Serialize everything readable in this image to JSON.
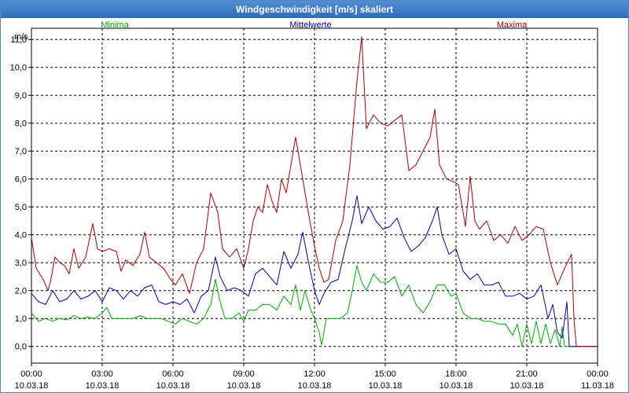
{
  "window": {
    "title": "Windgeschwindigkeit [m/s] skaliert"
  },
  "chart_data": {
    "type": "line",
    "title": "Windgeschwindigkeit [m/s] skaliert",
    "ylabel": "m/s",
    "xlabel": "",
    "ylim": [
      -0.6,
      11.4
    ],
    "grid": true,
    "legend_position": "top",
    "y_ticks": [
      "11,0",
      "10,0",
      "9,0",
      "8,0",
      "7,0",
      "6,0",
      "5,0",
      "4,0",
      "3,0",
      "2,0",
      "1,0",
      "0,0"
    ],
    "y_tick_values": [
      11,
      10,
      9,
      8,
      7,
      6,
      5,
      4,
      3,
      2,
      1,
      0
    ],
    "x_ticks": [
      {
        "time": "00:00",
        "date": "10.03.18"
      },
      {
        "time": "03:00",
        "date": "10.03.18"
      },
      {
        "time": "06:00",
        "date": "10.03.18"
      },
      {
        "time": "09:00",
        "date": "10.03.18"
      },
      {
        "time": "12:00",
        "date": "10.03.18"
      },
      {
        "time": "15:00",
        "date": "10.03.18"
      },
      {
        "time": "18:00",
        "date": "10.03.18"
      },
      {
        "time": "21:00",
        "date": "10.03.18"
      },
      {
        "time": "00:00",
        "date": "11.03.18"
      }
    ],
    "x_tick_hours": [
      0,
      3,
      6,
      9,
      12,
      15,
      18,
      21,
      24
    ],
    "x_unit": "hours since 10.03.18 00:00",
    "series": [
      {
        "name": "Minima",
        "color": "#00aa00",
        "points": [
          [
            0,
            1.2
          ],
          [
            0.3,
            0.9
          ],
          [
            0.6,
            1.0
          ],
          [
            0.9,
            0.9
          ],
          [
            1.2,
            1.0
          ],
          [
            1.5,
            0.95
          ],
          [
            1.8,
            1.1
          ],
          [
            2.1,
            1.0
          ],
          [
            2.4,
            1.05
          ],
          [
            2.7,
            1.0
          ],
          [
            3.0,
            1.2
          ],
          [
            3.2,
            1.4
          ],
          [
            3.4,
            1.0
          ],
          [
            3.7,
            1.0
          ],
          [
            4.0,
            1.0
          ],
          [
            4.3,
            1.0
          ],
          [
            4.6,
            1.1
          ],
          [
            4.9,
            1.0
          ],
          [
            5.2,
            1.0
          ],
          [
            5.5,
            1.0
          ],
          [
            5.8,
            0.9
          ],
          [
            6.1,
            0.8
          ],
          [
            6.4,
            1.0
          ],
          [
            6.7,
            0.9
          ],
          [
            7.0,
            0.8
          ],
          [
            7.3,
            1.0
          ],
          [
            7.6,
            1.5
          ],
          [
            7.8,
            2.4
          ],
          [
            8.0,
            1.6
          ],
          [
            8.2,
            1.0
          ],
          [
            8.5,
            1.0
          ],
          [
            8.8,
            1.2
          ],
          [
            9.0,
            0.9
          ],
          [
            9.2,
            1.3
          ],
          [
            9.5,
            1.3
          ],
          [
            9.8,
            1.5
          ],
          [
            10.1,
            1.5
          ],
          [
            10.4,
            1.3
          ],
          [
            10.7,
            1.8
          ],
          [
            11.0,
            1.5
          ],
          [
            11.2,
            2.2
          ],
          [
            11.4,
            1.3
          ],
          [
            11.6,
            2.0
          ],
          [
            11.8,
            1.4
          ],
          [
            12.0,
            1.0
          ],
          [
            12.2,
            0.5
          ],
          [
            12.3,
            0.05
          ],
          [
            12.5,
            1.0
          ],
          [
            12.8,
            1.0
          ],
          [
            13.1,
            1.0
          ],
          [
            13.4,
            1.2
          ],
          [
            13.6,
            2.0
          ],
          [
            13.8,
            2.9
          ],
          [
            14.0,
            2.3
          ],
          [
            14.2,
            2.0
          ],
          [
            14.5,
            2.6
          ],
          [
            14.8,
            2.3
          ],
          [
            15.1,
            2.3
          ],
          [
            15.4,
            2.5
          ],
          [
            15.7,
            1.8
          ],
          [
            16.0,
            2.2
          ],
          [
            16.3,
            1.5
          ],
          [
            16.6,
            1.2
          ],
          [
            16.9,
            1.6
          ],
          [
            17.2,
            2.2
          ],
          [
            17.5,
            2.2
          ],
          [
            17.8,
            1.8
          ],
          [
            18.0,
            1.9
          ],
          [
            18.3,
            1.2
          ],
          [
            18.6,
            1.0
          ],
          [
            18.9,
            1.0
          ],
          [
            19.2,
            0.9
          ],
          [
            19.5,
            0.9
          ],
          [
            19.8,
            0.8
          ],
          [
            20.1,
            0.8
          ],
          [
            20.4,
            0.4
          ],
          [
            20.6,
            0.8
          ],
          [
            20.8,
            0.0
          ],
          [
            21.0,
            0.8
          ],
          [
            21.2,
            0.1
          ],
          [
            21.4,
            0.9
          ],
          [
            21.6,
            0.1
          ],
          [
            21.8,
            0.8
          ],
          [
            22.0,
            0.1
          ],
          [
            22.2,
            0.6
          ],
          [
            22.4,
            0.0
          ],
          [
            22.5,
            0.7
          ],
          [
            22.6,
            0.0
          ],
          [
            22.8,
            0.0
          ],
          [
            23.2,
            0.0
          ],
          [
            24.0,
            0.0
          ]
        ]
      },
      {
        "name": "Mittelwerte",
        "color": "#0000aa",
        "points": [
          [
            0,
            1.9
          ],
          [
            0.3,
            1.6
          ],
          [
            0.6,
            1.5
          ],
          [
            0.9,
            2.0
          ],
          [
            1.2,
            1.6
          ],
          [
            1.5,
            1.7
          ],
          [
            1.8,
            2.0
          ],
          [
            2.1,
            1.7
          ],
          [
            2.4,
            1.8
          ],
          [
            2.7,
            2.0
          ],
          [
            3.0,
            1.6
          ],
          [
            3.3,
            2.1
          ],
          [
            3.6,
            2.0
          ],
          [
            3.9,
            1.7
          ],
          [
            4.2,
            2.0
          ],
          [
            4.5,
            1.8
          ],
          [
            4.8,
            2.1
          ],
          [
            5.1,
            2.2
          ],
          [
            5.4,
            1.6
          ],
          [
            5.7,
            1.5
          ],
          [
            6.0,
            1.6
          ],
          [
            6.3,
            1.5
          ],
          [
            6.6,
            1.7
          ],
          [
            6.9,
            1.2
          ],
          [
            7.2,
            1.8
          ],
          [
            7.5,
            2.0
          ],
          [
            7.8,
            3.2
          ],
          [
            8.0,
            2.5
          ],
          [
            8.3,
            2.0
          ],
          [
            8.6,
            2.1
          ],
          [
            8.9,
            2.0
          ],
          [
            9.2,
            1.8
          ],
          [
            9.5,
            2.6
          ],
          [
            9.8,
            2.8
          ],
          [
            10.1,
            2.5
          ],
          [
            10.4,
            2.2
          ],
          [
            10.7,
            3.4
          ],
          [
            11.0,
            2.8
          ],
          [
            11.3,
            3.3
          ],
          [
            11.5,
            4.1
          ],
          [
            11.7,
            3.2
          ],
          [
            12.0,
            2.0
          ],
          [
            12.2,
            1.5
          ],
          [
            12.4,
            1.9
          ],
          [
            12.7,
            2.3
          ],
          [
            13.0,
            2.4
          ],
          [
            13.3,
            3.5
          ],
          [
            13.6,
            4.5
          ],
          [
            13.8,
            5.4
          ],
          [
            14.0,
            4.4
          ],
          [
            14.3,
            5.0
          ],
          [
            14.6,
            4.5
          ],
          [
            14.9,
            4.2
          ],
          [
            15.2,
            4.3
          ],
          [
            15.5,
            4.6
          ],
          [
            15.8,
            3.9
          ],
          [
            16.1,
            3.4
          ],
          [
            16.4,
            3.6
          ],
          [
            16.7,
            3.9
          ],
          [
            17.0,
            4.5
          ],
          [
            17.2,
            5.0
          ],
          [
            17.4,
            4.0
          ],
          [
            17.7,
            3.3
          ],
          [
            18.0,
            3.5
          ],
          [
            18.3,
            2.7
          ],
          [
            18.6,
            2.4
          ],
          [
            18.9,
            2.6
          ],
          [
            19.2,
            2.2
          ],
          [
            19.5,
            2.2
          ],
          [
            19.8,
            2.3
          ],
          [
            20.1,
            1.8
          ],
          [
            20.4,
            1.8
          ],
          [
            20.7,
            1.9
          ],
          [
            21.0,
            1.7
          ],
          [
            21.3,
            1.8
          ],
          [
            21.6,
            2.2
          ],
          [
            21.9,
            1.0
          ],
          [
            22.1,
            1.5
          ],
          [
            22.3,
            0.5
          ],
          [
            22.5,
            0.3
          ],
          [
            22.7,
            1.6
          ],
          [
            22.8,
            0.0
          ],
          [
            23.0,
            0.0
          ],
          [
            24.0,
            0.0
          ]
        ]
      },
      {
        "name": "Maxima",
        "color": "#aa0000",
        "points": [
          [
            0,
            3.9
          ],
          [
            0.2,
            2.8
          ],
          [
            0.5,
            2.4
          ],
          [
            0.7,
            2.0
          ],
          [
            0.8,
            2.3
          ],
          [
            1.0,
            3.2
          ],
          [
            1.2,
            3.0
          ],
          [
            1.4,
            2.9
          ],
          [
            1.6,
            2.6
          ],
          [
            1.8,
            3.5
          ],
          [
            2.0,
            2.8
          ],
          [
            2.3,
            3.2
          ],
          [
            2.6,
            4.4
          ],
          [
            2.8,
            3.5
          ],
          [
            3.0,
            3.4
          ],
          [
            3.3,
            3.5
          ],
          [
            3.6,
            3.4
          ],
          [
            3.8,
            2.7
          ],
          [
            4.0,
            3.1
          ],
          [
            4.3,
            2.9
          ],
          [
            4.6,
            3.3
          ],
          [
            4.8,
            4.1
          ],
          [
            5.0,
            3.2
          ],
          [
            5.3,
            3.0
          ],
          [
            5.6,
            2.8
          ],
          [
            5.9,
            2.4
          ],
          [
            6.1,
            2.2
          ],
          [
            6.4,
            2.6
          ],
          [
            6.7,
            1.9
          ],
          [
            7.0,
            3.0
          ],
          [
            7.3,
            3.5
          ],
          [
            7.6,
            5.5
          ],
          [
            7.9,
            4.8
          ],
          [
            8.1,
            3.5
          ],
          [
            8.4,
            3.2
          ],
          [
            8.7,
            3.5
          ],
          [
            9.0,
            2.8
          ],
          [
            9.2,
            3.5
          ],
          [
            9.4,
            4.5
          ],
          [
            9.6,
            5.0
          ],
          [
            9.8,
            4.8
          ],
          [
            10.0,
            5.8
          ],
          [
            10.2,
            5.2
          ],
          [
            10.4,
            4.8
          ],
          [
            10.6,
            6.0
          ],
          [
            10.8,
            5.5
          ],
          [
            11.0,
            6.5
          ],
          [
            11.2,
            7.5
          ],
          [
            11.4,
            6.5
          ],
          [
            11.6,
            5.5
          ],
          [
            11.8,
            4.5
          ],
          [
            12.0,
            3.6
          ],
          [
            12.2,
            2.8
          ],
          [
            12.4,
            2.3
          ],
          [
            12.6,
            2.4
          ],
          [
            12.9,
            3.8
          ],
          [
            13.2,
            4.5
          ],
          [
            13.5,
            6.5
          ],
          [
            13.8,
            9.5
          ],
          [
            14.0,
            11.1
          ],
          [
            14.2,
            7.8
          ],
          [
            14.5,
            8.3
          ],
          [
            14.8,
            8.0
          ],
          [
            15.1,
            7.9
          ],
          [
            15.4,
            8.1
          ],
          [
            15.7,
            8.3
          ],
          [
            16.0,
            6.3
          ],
          [
            16.3,
            6.5
          ],
          [
            16.6,
            7.0
          ],
          [
            16.9,
            7.5
          ],
          [
            17.1,
            8.5
          ],
          [
            17.3,
            6.5
          ],
          [
            17.6,
            6.0
          ],
          [
            17.9,
            5.9
          ],
          [
            18.1,
            5.8
          ],
          [
            18.4,
            4.3
          ],
          [
            18.6,
            6.1
          ],
          [
            18.8,
            4.5
          ],
          [
            19.0,
            4.2
          ],
          [
            19.3,
            4.5
          ],
          [
            19.6,
            3.8
          ],
          [
            19.9,
            4.0
          ],
          [
            20.2,
            3.7
          ],
          [
            20.5,
            4.3
          ],
          [
            20.8,
            3.8
          ],
          [
            21.1,
            4.0
          ],
          [
            21.4,
            4.3
          ],
          [
            21.7,
            4.2
          ],
          [
            22.0,
            3.0
          ],
          [
            22.3,
            2.2
          ],
          [
            22.6,
            2.8
          ],
          [
            22.9,
            3.3
          ],
          [
            23.0,
            1.0
          ],
          [
            23.1,
            0.0
          ],
          [
            24.0,
            0.0
          ]
        ]
      }
    ]
  }
}
